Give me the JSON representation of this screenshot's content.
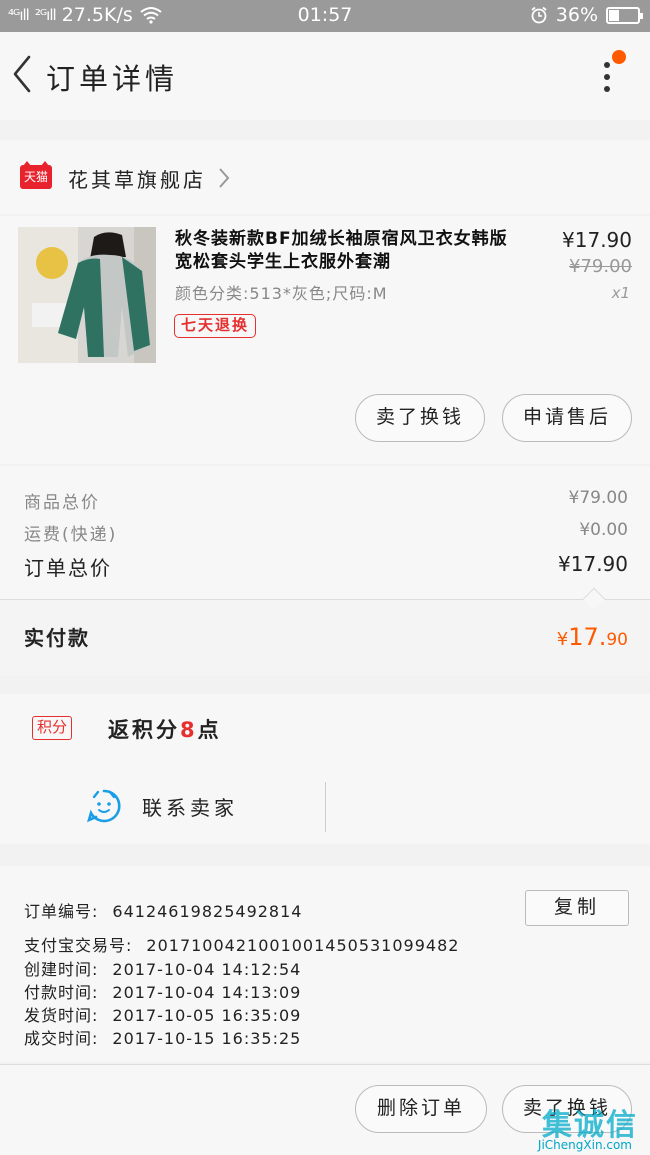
{
  "status_bar": {
    "signal1": "⁴ᴳıll",
    "signal2": "²ᴳıll",
    "speed": "27.5K/s",
    "time": "01:57",
    "battery": "36%",
    "battery_level": 0.36
  },
  "nav": {
    "title": "订单详情"
  },
  "store": {
    "logo": "天猫",
    "name": "花其草旗舰店"
  },
  "product": {
    "title": "秋冬装新款BF加绒长袖原宿风卫衣女韩版宽松套头学生上衣服外套潮",
    "spec": "颜色分类:513*灰色;尺码:M",
    "tag": "七天退换",
    "price": "¥17.90",
    "original_price": "¥79.00",
    "quantity": "x1",
    "btn_sell_exchange": "卖了换钱",
    "btn_after_sales": "申请售后"
  },
  "totals": {
    "goods_label": "商品总价",
    "goods_value": "¥79.00",
    "shipping_label": "运费(快递)",
    "shipping_value": "¥0.00",
    "order_label": "订单总价",
    "order_value": "¥17.90",
    "paid_label": "实付款",
    "paid_currency": "¥",
    "paid_int": "17.",
    "paid_dec": "90"
  },
  "points": {
    "badge": "积分",
    "text_prefix": "返积分",
    "amount": "8",
    "text_suffix": "点"
  },
  "contact": {
    "label": "联系卖家"
  },
  "order_info": {
    "copy_button": "复制",
    "rows": [
      {
        "label": "订单编号:",
        "value": "64124619825492814"
      },
      {
        "label": "支付宝交易号:",
        "value": "2017100421001001450531099482"
      },
      {
        "label": "创建时间:",
        "value": "2017-10-04 14:12:54"
      },
      {
        "label": "付款时间:",
        "value": "2017-10-04 14:13:09"
      },
      {
        "label": "发货时间:",
        "value": "2017-10-05 16:35:09"
      },
      {
        "label": "成交时间:",
        "value": "2017-10-15 16:35:25"
      }
    ]
  },
  "footer": {
    "delete_order": "删除订单",
    "sell_exchange": "卖了换钱"
  },
  "watermark": {
    "main": "集诚信",
    "sub": "JiChengXin.com"
  },
  "colors": {
    "accent": "#ff5a00",
    "tmall_red": "#e5302f",
    "contact_blue": "#1a9ee8"
  }
}
